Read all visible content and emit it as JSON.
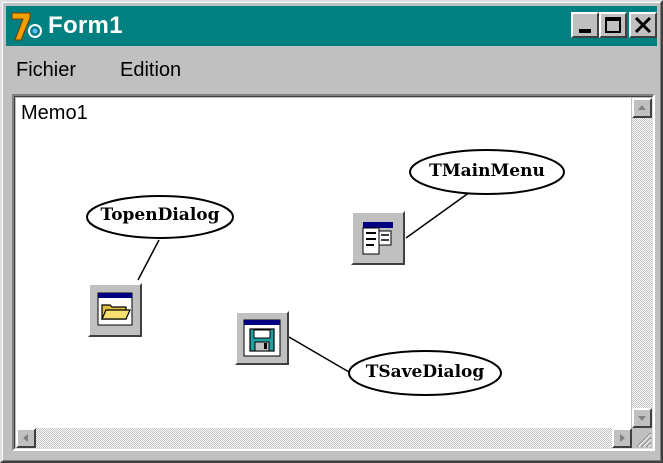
{
  "window": {
    "title": "Form1",
    "app_icon": "delphi-app-icon",
    "controls": {
      "minimize": "minimize-icon",
      "maximize": "maximize-icon",
      "close": "close-icon",
      "close_glyph": "✕"
    }
  },
  "menu": {
    "items": [
      "Fichier",
      "Edition"
    ]
  },
  "memo": {
    "text": "Memo1"
  },
  "components": [
    {
      "label": "TopenDialog",
      "icon": "open-folder-icon"
    },
    {
      "label": "TMainMenu",
      "icon": "menu-icon"
    },
    {
      "label": "TSaveDialog",
      "icon": "floppy-save-icon"
    }
  ],
  "colors": {
    "titlebar": "#008080",
    "face": "#c0c0c0",
    "memo_bg": "#ffffff"
  }
}
